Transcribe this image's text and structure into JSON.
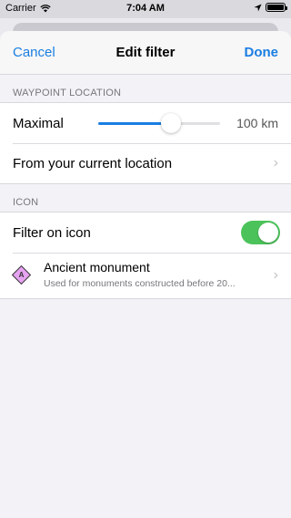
{
  "status_bar": {
    "carrier": "Carrier",
    "time": "7:04 AM"
  },
  "nav": {
    "cancel_label": "Cancel",
    "title": "Edit filter",
    "done_label": "Done"
  },
  "waypoint_location": {
    "header": "WAYPOINT LOCATION",
    "maximal_label": "Maximal",
    "slider_value_fraction": 0.6,
    "slider_value_text": "100 km",
    "from_location_label": "From your current location"
  },
  "icon_section": {
    "header": "ICON",
    "filter_label": "Filter on icon",
    "filter_enabled": true,
    "poi": {
      "icon_letter": "A",
      "icon_color": "#e5a3f0",
      "title": "Ancient monument",
      "subtitle": "Used for monuments constructed before 20..."
    }
  },
  "colors": {
    "accent": "#1a7ee2",
    "toggle_on": "#4cc35a"
  }
}
